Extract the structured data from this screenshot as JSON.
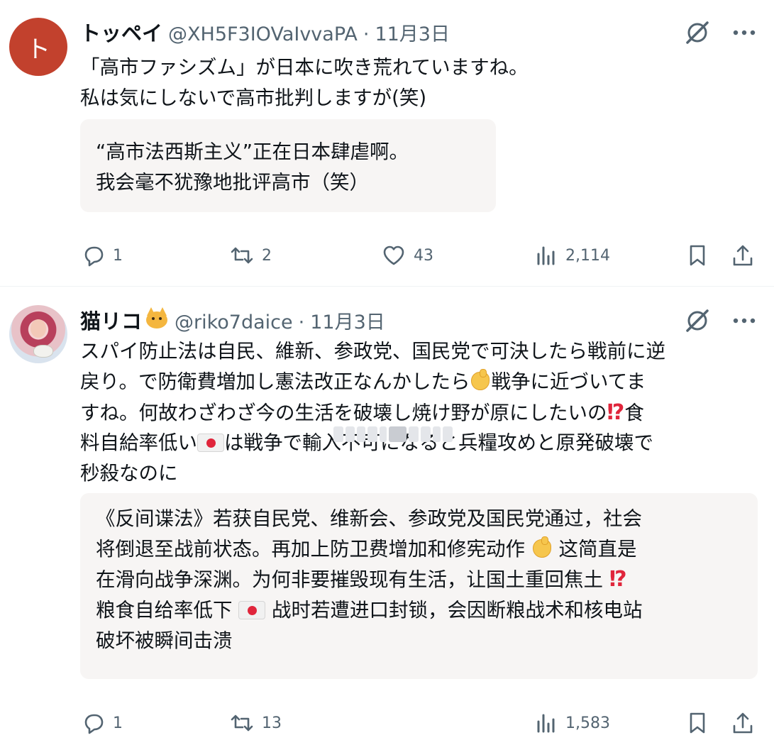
{
  "tweets": [
    {
      "avatar_letter": "ト",
      "display_name": "トッペイ",
      "handle": "@XH5F3IOVaIvvaPA",
      "separator": "·",
      "date": "11月3日",
      "text_lines": [
        "「高市ファシズム」が日本に吹き荒れていますね。",
        "私は気にしないで高市批判しますが(笑)"
      ],
      "translation_lines": [
        "“高市法西斯主义”正在日本肆虐啊。",
        "我会毫不犹豫地批评高市（笑）"
      ],
      "stats": {
        "replies": "1",
        "reposts": "2",
        "likes": "43",
        "views": "2,114"
      }
    },
    {
      "display_name": "猫リコ",
      "name_emoji": "cat-face-icon",
      "handle": "@riko7daice",
      "separator": "·",
      "date": "11月3日",
      "text_lines": [
        {
          "a": "スパイ防止法は自民、維新、参政党、国民党で可決したら戦前に逆"
        },
        {
          "a": "戻り。で防衛費増加し憲法改正なんかしたら",
          "b": "戦争に近づいてま"
        },
        {
          "a": "すね。何故わざわざ今の生活を破壊し焼け野が原にしたいの",
          "b": "食"
        },
        {
          "a": "料自給率低い",
          "b": "は戦争で輸入不可になると兵糧攻めと原発破壊で"
        },
        {
          "a": "秒殺なのに"
        }
      ],
      "translation_lines": [
        {
          "a": "《反间谍法》若获自民党、维新会、参政党及国民党通过，社会"
        },
        {
          "a": "将倒退至战前状态。再加上防卫费增加和修宪动作 ",
          "b": " 这简直是"
        },
        {
          "a": "在滑向战争深渊。为何非要摧毁现有生活，让国土重回焦土 "
        },
        {
          "a": "粮食自给率低下 ",
          "b": " 战时若遭进口封锁，会因断粮战术和核电站"
        },
        {
          "a": "破坏被瞬间击溃"
        }
      ],
      "interrobang": "⁉",
      "stats": {
        "replies": "1",
        "reposts": "13",
        "views": "1,583"
      }
    }
  ],
  "icons": {
    "grok": "grok-icon",
    "more": "more-icon",
    "reply": "reply-icon",
    "repost": "repost-icon",
    "like": "like-icon",
    "views": "views-icon",
    "bookmark": "bookmark-icon",
    "share": "share-icon",
    "flag": "japan-flag-icon",
    "hand": "pointing-hand-icon"
  },
  "colors": {
    "text": "#0f1419",
    "secondary": "#536471",
    "translation_bg": "#f7f5f4",
    "avatar_bg": "#c2412d",
    "divider": "#eff3f4"
  }
}
